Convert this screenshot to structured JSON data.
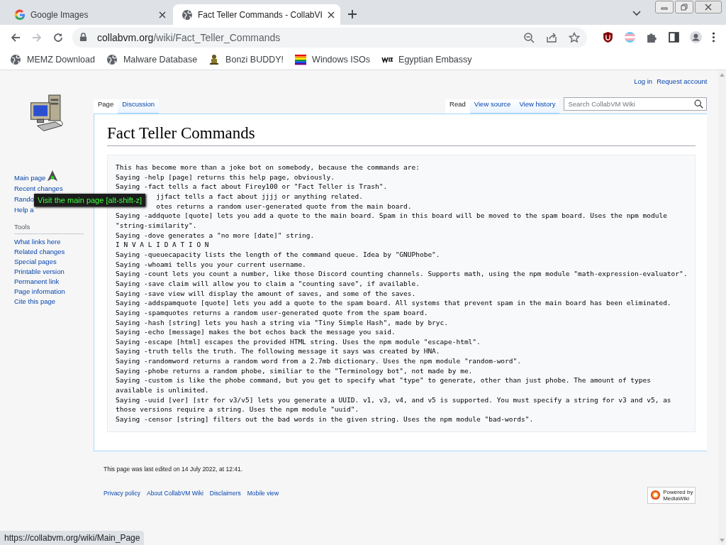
{
  "browser": {
    "tabs": [
      {
        "title": "Google Images",
        "kind": "google",
        "selected": false
      },
      {
        "title": "Fact Teller Commands - CollabVI",
        "kind": "globe",
        "selected": true
      }
    ],
    "address": {
      "host": "collabvm.org",
      "path": "/wiki/Fact_Teller_Commands"
    },
    "bookmarks": [
      {
        "label": "MEMZ Download",
        "kind": "globe"
      },
      {
        "label": "Malware Database",
        "kind": "globe"
      },
      {
        "label": "Bonzi BUDDY!",
        "kind": "figure"
      },
      {
        "label": "Windows ISOs",
        "kind": "flag"
      },
      {
        "label": "Egyptian Embassy",
        "kind": "wix"
      }
    ],
    "status_url": "https://collabvm.org/wiki/Main_Page"
  },
  "wiki": {
    "personal": [
      "Log in",
      "Request account"
    ],
    "left_tabs": [
      {
        "label": "Page",
        "selected": true
      },
      {
        "label": "Discussion",
        "selected": false
      }
    ],
    "right_tabs": [
      {
        "label": "Read",
        "selected": true
      },
      {
        "label": "View source",
        "selected": false
      },
      {
        "label": "View history",
        "selected": false
      }
    ],
    "search": {
      "placeholder": "Search CollabVM Wiki"
    },
    "navigation": [
      "Main page",
      "Recent changes",
      "Rando",
      "Help a"
    ],
    "tools": {
      "heading": "Tools",
      "items": [
        "What links here",
        "Related changes",
        "Special pages",
        "Printable version",
        "Permanent link",
        "Page information",
        "Cite this page"
      ]
    },
    "tooltip": "Visit the main page [alt-shift-z]",
    "title": "Fact Teller Commands",
    "lines": [
      {
        "text": "This has become more than a joke bot on somebody, because the commands are:"
      },
      {
        "text": "Saying -help [page] returns this help page, obviously."
      },
      {
        "text": "Saying -fact tells a fact about Firey100 or \"Fact Teller is Trash\"."
      },
      {
        "text": "jjfact tells a fact about jjjj or anything related.",
        "kind": "covered"
      },
      {
        "text": "otes returns a random user-generated quote from the main board.",
        "kind": "covered"
      },
      {
        "text": "Saying -addquote [quote] lets you add a quote to the main board. Spam in this board will be moved to the spam board. Uses the npm module"
      },
      {
        "text": "\"string-similarity\"."
      },
      {
        "text": "Saying -dove generates a \"no more [date]\" string."
      },
      {
        "text": "I N V A L I D A T I O N"
      },
      {
        "text": "Saying -queuecapacity lists the length of the command queue. Idea by \"GNUPhobe\"."
      },
      {
        "text": "Saying -whoami tells you your current username."
      },
      {
        "text": "Saying -count lets you count a number, like those Discord counting channels. Supports math, using the npm module \"math-expression-evaluator\"."
      },
      {
        "text": "Saying -save claim will allow you to claim a \"counting save\", if available."
      },
      {
        "text": "Saying -save view will display the amount of saves, and some of the saves."
      },
      {
        "text": "Saying -addspamquote [quote] lets you add a quote to the spam board. All systems that prevent spam in the main board has been eliminated."
      },
      {
        "text": "Saying -spamquotes returns a random user-generated quote from the spam board."
      },
      {
        "text": "Saying -hash [string] lets you hash a string via \"Tiny Simple Hash\", made by bryc."
      },
      {
        "text": "Saying -echo [message] makes the bot echos back the message you said."
      },
      {
        "text": "Saying -escape [html] escapes the provided HTML string. Uses the npm module \"escape-html\"."
      },
      {
        "text": "Saying -truth tells the truth. The following message it says was created by HNA."
      },
      {
        "text": "Saying -randomword returns a random word from a 2.7mb dictionary. Uses the npm module \"random-word\"."
      },
      {
        "text": "Saying -phobe returns a random phobe, similiar to the \"Terminology bot\", not made by me."
      },
      {
        "text": "Saying -custom is like the phobe command, but you get to specify what \"type\" to generate, other than just phobe. The amount of types"
      },
      {
        "text": "available is unlimited."
      },
      {
        "text": "Saying -uuid [ver] [str for v3/v5] lets you generate a UUID. v1, v3, v4, and v5 is supported. You must specify a string for v3 and v5, as"
      },
      {
        "text": "those versions require a string. Uses the npm module \"uuid\"."
      },
      {
        "text": "Saying -censor [string] filters out the bad words in the given string. Uses the npm module \"bad-words\"."
      }
    ],
    "last_edited": "This page was last edited on 14 July 2022, at 12:41.",
    "footer_links": [
      "Privacy policy",
      "About CollabVM Wiki",
      "Disclaimers",
      "Mobile view"
    ],
    "powered_by": [
      "Powered by",
      "MediaWiki"
    ]
  }
}
